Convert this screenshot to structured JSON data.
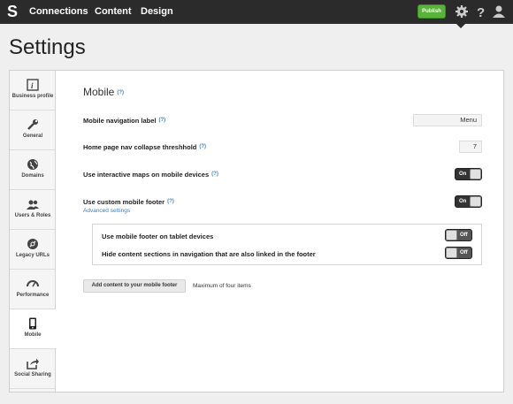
{
  "topbar": {
    "logo": "S",
    "nav": [
      "Connections",
      "Content",
      "Design"
    ],
    "publish_label": "Publish",
    "icons": [
      "gear-icon",
      "help-icon",
      "user-icon"
    ]
  },
  "page_title": "Settings",
  "sidebar": {
    "items": [
      {
        "label": "Business profile",
        "icon": "info-icon"
      },
      {
        "label": "General",
        "icon": "wrench-icon"
      },
      {
        "label": "Domains",
        "icon": "globe-icon"
      },
      {
        "label": "Users & Roles",
        "icon": "users-icon"
      },
      {
        "label": "Legacy URLs",
        "icon": "link-icon"
      },
      {
        "label": "Performance",
        "icon": "gauge-icon"
      },
      {
        "label": "Mobile",
        "icon": "mobile-icon",
        "active": true
      },
      {
        "label": "Social Sharing",
        "icon": "share-icon"
      }
    ]
  },
  "mobile": {
    "title": "Mobile",
    "help": "(?)",
    "nav_label": {
      "label": "Mobile navigation label",
      "value": "Menu"
    },
    "collapse": {
      "label": "Home page nav collapse threshhold",
      "value": "7"
    },
    "maps": {
      "label": "Use interactive maps on mobile devices",
      "state": "On"
    },
    "footer": {
      "label": "Use custom mobile footer",
      "state": "On"
    },
    "advanced_link": "Advanced settings",
    "tablet": {
      "label": "Use mobile footer on tablet devices",
      "state": "Off"
    },
    "hide_sections": {
      "label": "Hide content sections in navigation that are also linked in the footer",
      "state": "Off"
    },
    "add_button": "Add content to your mobile footer",
    "add_note": "Maximum of four items"
  }
}
